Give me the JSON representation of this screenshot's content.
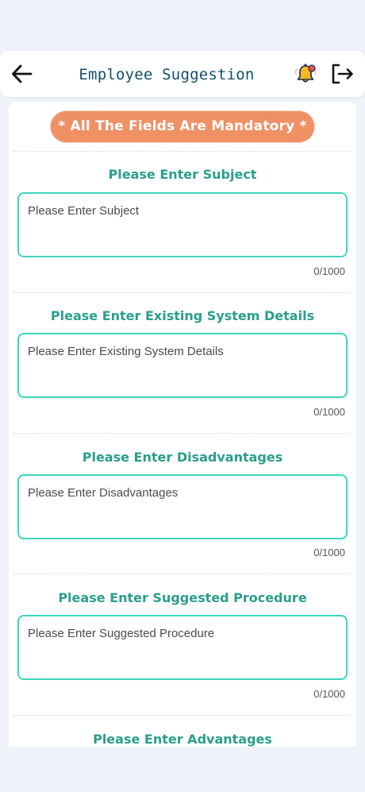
{
  "header": {
    "title": "Employee Suggestion",
    "back_icon": "arrow-left-icon",
    "bell_icon": "bell-notification-icon",
    "logout_icon": "logout-icon"
  },
  "notice": "* All The Fields Are Mandatory *",
  "sections": [
    {
      "title": "Please Enter Subject",
      "placeholder": "Please Enter Subject",
      "counter": "0/1000"
    },
    {
      "title": "Please Enter Existing System Details",
      "placeholder": "Please Enter Existing System Details",
      "counter": "0/1000"
    },
    {
      "title": "Please Enter Disadvantages",
      "placeholder": "Please Enter Disadvantages",
      "counter": "0/1000"
    },
    {
      "title": "Please Enter Suggested Procedure",
      "placeholder": "Please Enter Suggested Procedure",
      "counter": "0/1000"
    },
    {
      "title": "Please Enter Advantages"
    }
  ],
  "colors": {
    "accent": "#2a9e8c",
    "field_border": "#3dd6bd",
    "notice_bg": "#ef9065",
    "title": "#13506b",
    "background": "#eff3f9"
  }
}
